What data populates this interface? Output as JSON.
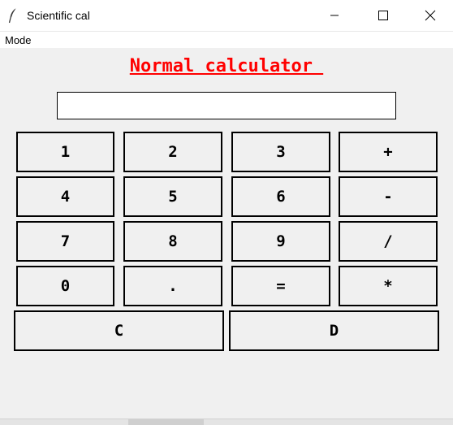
{
  "window": {
    "title": "Scientific cal",
    "icons": {
      "app": "feather-icon",
      "minimize": "minimize-icon",
      "maximize": "maximize-icon",
      "close": "close-icon"
    }
  },
  "menubar": {
    "items": [
      {
        "label": "Mode"
      }
    ]
  },
  "heading": {
    "text": "Normal calculator "
  },
  "display": {
    "value": "",
    "placeholder": ""
  },
  "keypad": {
    "rows": [
      [
        "1",
        "2",
        "3",
        "+"
      ],
      [
        "4",
        "5",
        "6",
        "-"
      ],
      [
        "7",
        "8",
        "9",
        "/"
      ],
      [
        "0",
        ".",
        "=",
        "*"
      ]
    ],
    "bottom": [
      "C",
      "D"
    ]
  },
  "colors": {
    "heading": "#ff0000",
    "background": "#f0f0f0",
    "border": "#000000"
  }
}
